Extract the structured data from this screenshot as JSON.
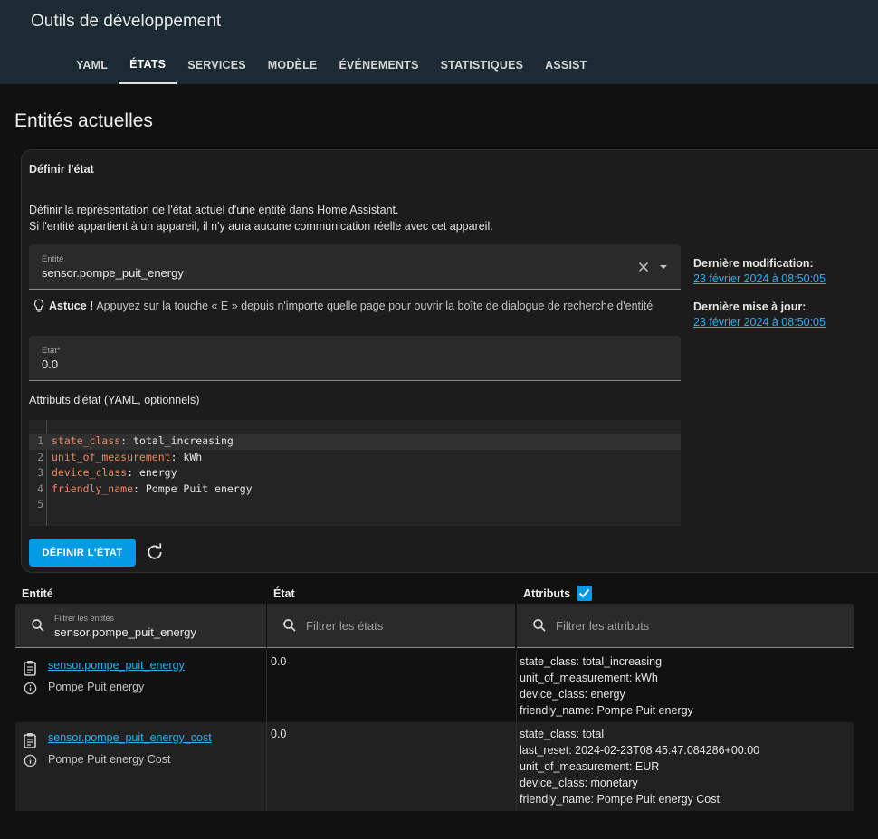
{
  "header": {
    "title": "Outils de développement",
    "tabs": [
      {
        "label": "YAML",
        "active": false
      },
      {
        "label": "ÉTATS",
        "active": true
      },
      {
        "label": "SERVICES",
        "active": false
      },
      {
        "label": "MODÈLE",
        "active": false
      },
      {
        "label": "ÉVÉNEMENTS",
        "active": false
      },
      {
        "label": "STATISTIQUES",
        "active": false
      },
      {
        "label": "ASSIST",
        "active": false
      }
    ]
  },
  "page_title": "Entités actuelles",
  "set_state": {
    "title": "Définir l'état",
    "description_line1": "Définir la représentation de l'état actuel d'une entité dans Home Assistant.",
    "description_line2": "Si l'entité appartient à un appareil, il n'y aura aucune communication réelle avec cet appareil.",
    "entity_label": "Entité",
    "entity_value": "sensor.pompe_puit_energy",
    "tip_strong": "Astuce !",
    "tip_text": "Appuyez sur la touche « E » depuis n'importe quelle page pour ouvrir la boîte de dialogue de recherche d'entité",
    "state_label": "Etat*",
    "state_value": "0.0",
    "attributes_label": "Attributs d'état (YAML, optionnels)",
    "yaml_lines": [
      {
        "num": "1",
        "key": "state_class",
        "value": "total_increasing"
      },
      {
        "num": "2",
        "key": "unit_of_measurement",
        "value": "kWh"
      },
      {
        "num": "3",
        "key": "device_class",
        "value": "energy"
      },
      {
        "num": "4",
        "key": "friendly_name",
        "value": "Pompe Puit energy"
      },
      {
        "num": "5",
        "key": "",
        "value": ""
      }
    ],
    "button_label": "DÉFINIR L'ÉTAT",
    "last_changed_label": "Dernière modification:",
    "last_changed_value": "23 février 2024 à 08:50:05",
    "last_updated_label": "Dernière mise à jour:",
    "last_updated_value": "23 février 2024 à 08:50:05"
  },
  "table": {
    "headers": {
      "entity": "Entité",
      "state": "État",
      "attributes": "Attributs"
    },
    "attributes_checked": true,
    "filters": {
      "entity_label": "Filtrer les entités",
      "entity_value": "sensor.pompe_puit_energy",
      "state_placeholder": "Filtrer les états",
      "attributes_placeholder": "Filtrer les attributs"
    },
    "rows": [
      {
        "entity_id": "sensor.pompe_puit_energy",
        "name": "Pompe Puit energy",
        "state": "0.0",
        "attributes": [
          "state_class: total_increasing",
          "unit_of_measurement: kWh",
          "device_class: energy",
          "friendly_name: Pompe Puit energy"
        ]
      },
      {
        "entity_id": "sensor.pompe_puit_energy_cost",
        "name": "Pompe Puit energy Cost",
        "state": "0.0",
        "attributes": [
          "state_class: total",
          "last_reset: 2024-02-23T08:45:47.084286+00:00",
          "unit_of_measurement: EUR",
          "device_class: monetary",
          "friendly_name: Pompe Puit energy Cost"
        ]
      }
    ]
  },
  "colors": {
    "accent": "#039be5",
    "link": "#2ab0f5",
    "header_bg": "#1c2a33",
    "yaml_key": "#e58962"
  }
}
